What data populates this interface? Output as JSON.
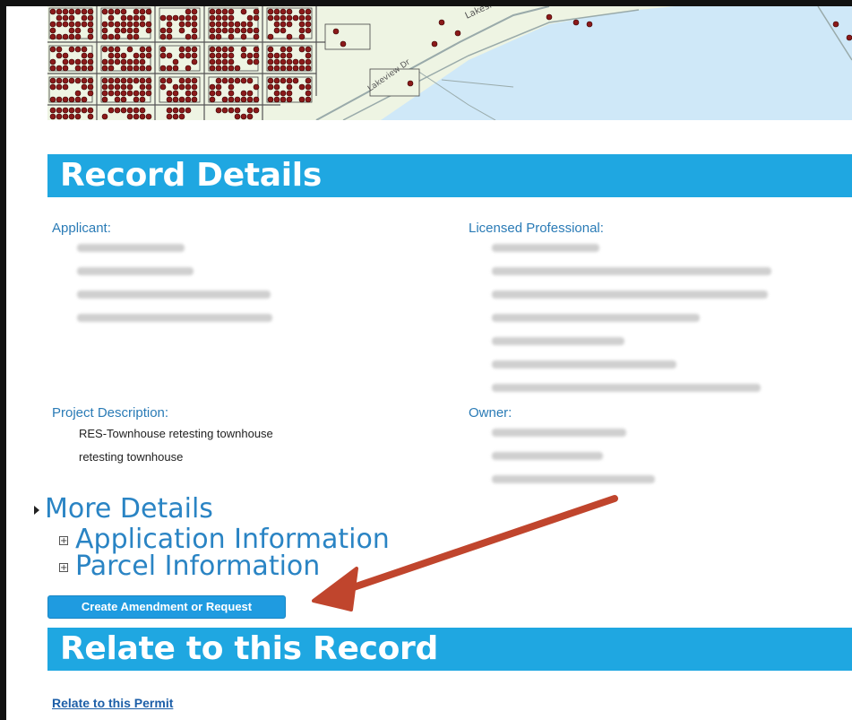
{
  "map": {
    "labels": [
      "Lakesho",
      "Lakeview Dr"
    ]
  },
  "record_details": {
    "header": "Record Details",
    "applicant": {
      "label": "Applicant:"
    },
    "licensed_professional": {
      "label": "Licensed Professional:"
    },
    "project_description": {
      "label": "Project Description:",
      "lines": [
        "RES-Townhouse retesting townhouse",
        "retesting townhouse"
      ]
    },
    "owner": {
      "label": "Owner:"
    }
  },
  "more_details": {
    "title": "More Details",
    "application_information": "Application Information",
    "parcel_information": "Parcel Information"
  },
  "create_amendment_button": "Create Amendment or Request",
  "relate": {
    "header": "Relate to this Record",
    "link": "Relate to this Permit"
  },
  "annotation": {
    "arrow_color": "#c0452d"
  },
  "colors": {
    "header_bg": "#1fa7e1",
    "label_blue": "#2a7bb6",
    "lake": "#cfe8f8",
    "parcel_red": "#8b1a1a"
  }
}
